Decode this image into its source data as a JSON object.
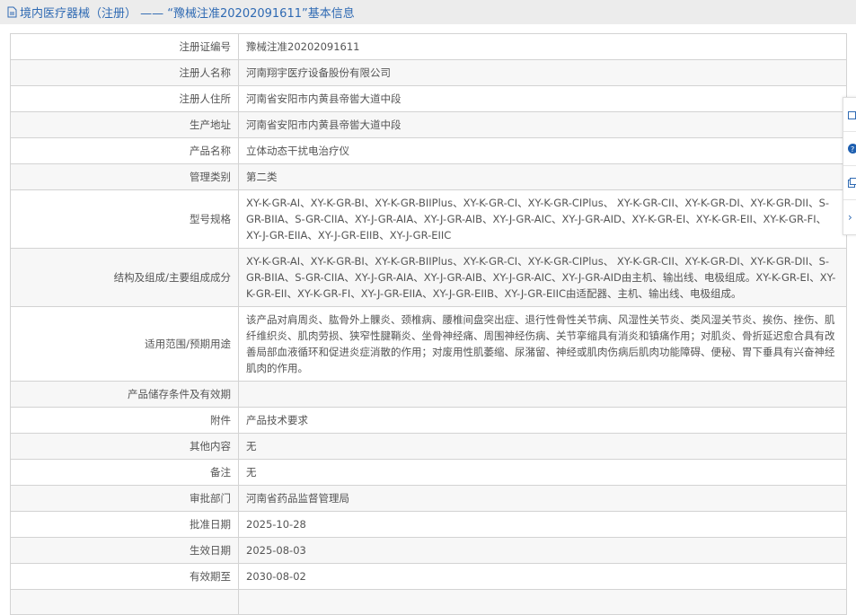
{
  "header": {
    "title": "境内医疗器械（注册） —— “豫械注准20202091611”基本信息",
    "icon": "document-icon"
  },
  "rows": [
    {
      "label": "注册证编号",
      "value": "豫械注准20202091611"
    },
    {
      "label": "注册人名称",
      "value": "河南翔宇医疗设备股份有限公司"
    },
    {
      "label": "注册人住所",
      "value": "河南省安阳市内黄县帝喾大道中段"
    },
    {
      "label": "生产地址",
      "value": "河南省安阳市内黄县帝喾大道中段"
    },
    {
      "label": "产品名称",
      "value": "立体动态干扰电治疗仪"
    },
    {
      "label": "管理类别",
      "value": "第二类"
    },
    {
      "label": "型号规格",
      "value": "XY-K-GR-AI、XY-K-GR-BI、XY-K-GR-BIIPlus、XY-K-GR-CI、XY-K-GR-CIPlus、 XY-K-GR-CII、XY-K-GR-DI、XY-K-GR-DII、S-GR-BIIA、S-GR-CIIA、XY-J-GR-AIA、XY-J-GR-AIB、XY-J-GR-AIC、XY-J-GR-AID、XY-K-GR-EI、XY-K-GR-EII、XY-K-GR-FI、XY-J-GR-EIIA、XY-J-GR-EIIB、XY-J-GR-EIIC"
    },
    {
      "label": "结构及组成/主要组成成分",
      "value": "XY-K-GR-AI、XY-K-GR-BI、XY-K-GR-BIIPlus、XY-K-GR-CI、XY-K-GR-CIPlus、 XY-K-GR-CII、XY-K-GR-DI、XY-K-GR-DII、S-GR-BIIA、S-GR-CIIA、XY-J-GR-AIA、XY-J-GR-AIB、XY-J-GR-AIC、XY-J-GR-AID由主机、输出线、电极组成。XY-K-GR-EI、XY-K-GR-EII、XY-K-GR-FI、XY-J-GR-EIIA、XY-J-GR-EIIB、XY-J-GR-EIIC由适配器、主机、输出线、电极组成。"
    },
    {
      "label": "适用范围/预期用途",
      "value": "该产品对肩周炎、肱骨外上髁炎、颈椎病、腰椎间盘突出症、退行性骨性关节病、风湿性关节炎、类风湿关节炎、挨伤、挫伤、肌纤维织炎、肌肉劳损、狭窄性腱鞘炎、坐骨神经痛、周围神经伤病、关节挛缩具有消炎和镇痛作用；对肌炎、骨折延迟愈合具有改善局部血液循环和促进炎症消散的作用；对废用性肌萎缩、尿潴留、神经或肌肉伤病后肌肉功能障碍、便秘、胃下垂具有兴奋神经肌肉的作用。"
    },
    {
      "label": "产品储存条件及有效期",
      "value": ""
    },
    {
      "label": "附件",
      "value": "产品技术要求"
    },
    {
      "label": "其他内容",
      "value": "无"
    },
    {
      "label": "备注",
      "value": "无"
    },
    {
      "label": "审批部门",
      "value": "河南省药品监督管理局"
    },
    {
      "label": "批准日期",
      "value": "2025-10-28"
    },
    {
      "label": "生效日期",
      "value": "2025-08-03"
    },
    {
      "label": "有效期至",
      "value": "2030-08-02"
    },
    {
      "label": "",
      "value": ""
    }
  ],
  "sidebar": {
    "icons": [
      "edit-icon",
      "help-icon",
      "copy-icon",
      "chevron-right-icon"
    ]
  }
}
